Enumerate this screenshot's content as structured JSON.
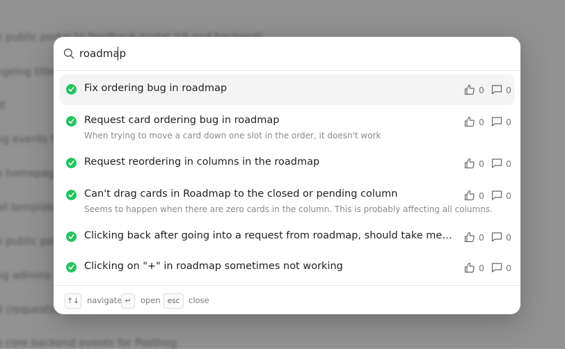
{
  "background": {
    "rows": [
      "e public portal to feedback portal (UI and backend)",
      "ngelog titles a",
      "st",
      "ng events fo",
      "o homepage",
      "ail templates",
      "o public porta",
      "ng admins th",
      "d (requests,",
      "e core backend events for Posthog"
    ]
  },
  "search": {
    "query": "roadmap"
  },
  "results": [
    {
      "title": "Fix ordering bug in roadmap",
      "description": "",
      "votes": "0",
      "comments": "0"
    },
    {
      "title": "Request card ordering bug in roadmap",
      "description": "When trying to move a card down one slot in the order, it doesn't work",
      "votes": "0",
      "comments": "0"
    },
    {
      "title": "Request reordering in columns in the roadmap",
      "description": "",
      "votes": "0",
      "comments": "0"
    },
    {
      "title": "Can't drag cards in Roadmap to the closed or pending column",
      "description": "Seems to happen when there are zero cards in the column. This is probably affecting all columns.",
      "votes": "0",
      "comments": "0"
    },
    {
      "title": "Clicking back after going into a request from roadmap, should take me back to ro...",
      "description": "",
      "votes": "0",
      "comments": "0"
    },
    {
      "title": "Clicking on \"+\" in roadmap sometimes not working",
      "description": "",
      "votes": "0",
      "comments": "0"
    }
  ],
  "footer": {
    "navigate_key": "↑↓",
    "navigate_label": "navigate",
    "open_key": "↵",
    "open_label": "open",
    "close_key": "esc",
    "close_label": "close"
  },
  "colors": {
    "status_check": "#22c55e",
    "active_row": "#f4f4f4"
  },
  "icons": {
    "search": "search-icon",
    "status": "check-circle-icon",
    "votes": "thumbs-up-icon",
    "comments": "comment-icon"
  }
}
